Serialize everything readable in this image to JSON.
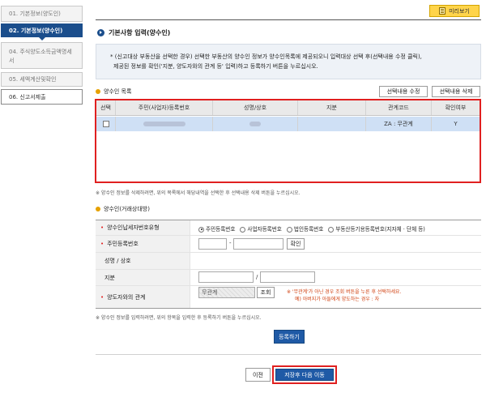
{
  "sidebar": {
    "steps": [
      {
        "label": "01. 기본정보(양도인)"
      },
      {
        "label": "02. 기본정보(양수인)"
      },
      {
        "label": "04. 주식양도소득금액명세서"
      },
      {
        "label": "05. 세액계산및확인"
      },
      {
        "label": "06. 신고서제출"
      }
    ]
  },
  "header": {
    "preview_label": "미리보기",
    "section_title": "기본사항 입력(양수인)"
  },
  "notice": {
    "line1": "* (신고대상 부동산을 선택한 경우) 선택한 부동산의 양수인 정보가 양수인목록에 제공되오니 입력대상 선택 후(선택내용 수정 클릭),",
    "line2": "제공된 정보를 확인('지분, 양도자와의 관계 등' 입력)하고 등록하기 버튼을 누르십시오."
  },
  "list": {
    "title": "양수인 목록",
    "edit_button": "선택내용 수정",
    "delete_button": "선택내용 삭제",
    "columns": [
      "선택",
      "주민(사업자)등록번호",
      "성명/상호",
      "지분",
      "관계코드",
      "확인여부"
    ],
    "rows": [
      {
        "relation": "ZA : 무관계",
        "confirmed": "Y"
      }
    ],
    "delete_hint": "※ 양수인 정보를 삭제하려면, 위의 목록에서 해당내역을 선택한 후 선택내용 삭제 버튼을 누르십시오."
  },
  "form": {
    "title": "양수인(거래상대방)",
    "type_label": "양수인납세자번호유형",
    "type_options": [
      "주민등록번호",
      "사업자등록번호",
      "법인등록번호",
      "부동산등기용등록번호(지자체 · 단체 등)"
    ],
    "id_label": "주민등록번호",
    "id_separator": "-",
    "confirm_button": "확인",
    "name_label": "성명 / 상호",
    "share_label": "지분",
    "share_separator": "/",
    "relation_label": "양도자와의 관계",
    "relation_value": "무관계",
    "lookup_button": "조회",
    "relation_note1": "※ '무관계'가 아닌 경우 조회 버튼을 누른 후 선택하세요.",
    "relation_note2": "예) 아버지가 아들에게 양도하는 경우 : 자",
    "register_hint": "※ 양수인 정보를 입력하려면, 위의 항목을 입력한 후 등록하기 버튼을 누르십시오.",
    "register_button": "등록하기"
  },
  "footer": {
    "prev_button": "이전",
    "next_button": "저장후 다음 이동"
  }
}
